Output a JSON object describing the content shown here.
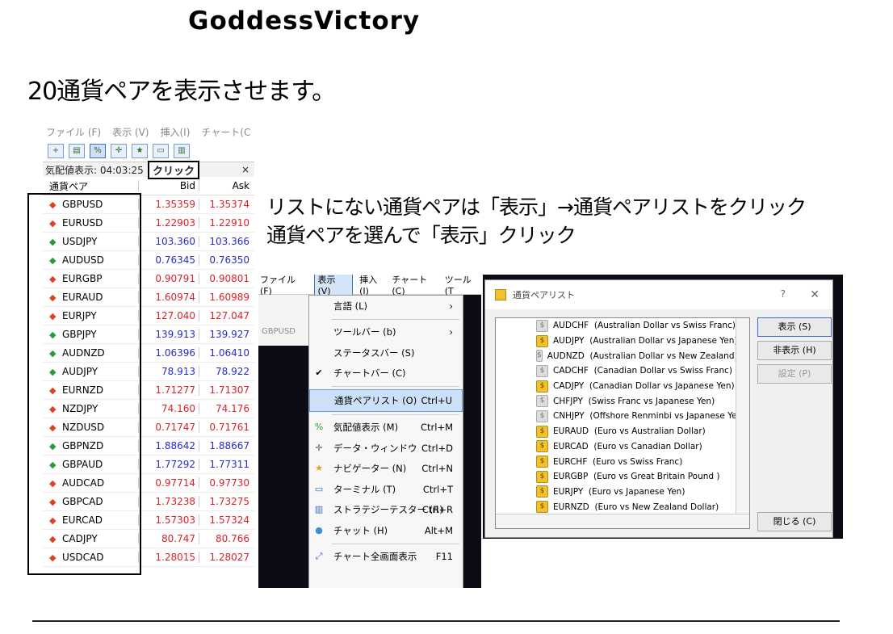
{
  "brand": "GoddessVictory",
  "heading": "20通貨ペアを表示させます。",
  "instruction": {
    "line1": "リストにない通貨ペアは「表示」→通貨ペアリストをクリック",
    "line2": "通貨ペアを選んで「表示」クリック"
  },
  "market_watch": {
    "menu": [
      "ファイル (F)",
      "表示 (V)",
      "挿入(I)",
      "チャート(C"
    ],
    "title": "気配値表示: 04:03:25",
    "click_label": "クリック",
    "close": "×",
    "headers": {
      "symbol": "通貨ペア",
      "bid": "Bid",
      "ask": "Ask"
    },
    "rows": [
      {
        "symbol": "GBPUSD",
        "bid": "1.35359",
        "ask": "1.35374",
        "dir": "down"
      },
      {
        "symbol": "EURUSD",
        "bid": "1.22903",
        "ask": "1.22910",
        "dir": "down"
      },
      {
        "symbol": "USDJPY",
        "bid": "103.360",
        "ask": "103.366",
        "dir": "up"
      },
      {
        "symbol": "AUDUSD",
        "bid": "0.76345",
        "ask": "0.76350",
        "dir": "up"
      },
      {
        "symbol": "EURGBP",
        "bid": "0.90791",
        "ask": "0.90801",
        "dir": "down"
      },
      {
        "symbol": "EURAUD",
        "bid": "1.60974",
        "ask": "1.60989",
        "dir": "down"
      },
      {
        "symbol": "EURJPY",
        "bid": "127.040",
        "ask": "127.047",
        "dir": "down"
      },
      {
        "symbol": "GBPJPY",
        "bid": "139.913",
        "ask": "139.927",
        "dir": "up"
      },
      {
        "symbol": "AUDNZD",
        "bid": "1.06396",
        "ask": "1.06410",
        "dir": "up"
      },
      {
        "symbol": "AUDJPY",
        "bid": "78.913",
        "ask": "78.922",
        "dir": "up"
      },
      {
        "symbol": "EURNZD",
        "bid": "1.71277",
        "ask": "1.71307",
        "dir": "down"
      },
      {
        "symbol": "NZDJPY",
        "bid": "74.160",
        "ask": "74.176",
        "dir": "down"
      },
      {
        "symbol": "NZDUSD",
        "bid": "0.71747",
        "ask": "0.71761",
        "dir": "down"
      },
      {
        "symbol": "GBPNZD",
        "bid": "1.88642",
        "ask": "1.88667",
        "dir": "up"
      },
      {
        "symbol": "GBPAUD",
        "bid": "1.77292",
        "ask": "1.77311",
        "dir": "up"
      },
      {
        "symbol": "AUDCAD",
        "bid": "0.97714",
        "ask": "0.97730",
        "dir": "down"
      },
      {
        "symbol": "GBPCAD",
        "bid": "1.73238",
        "ask": "1.73275",
        "dir": "down"
      },
      {
        "symbol": "EURCAD",
        "bid": "1.57303",
        "ask": "1.57324",
        "dir": "down"
      },
      {
        "symbol": "CADJPY",
        "bid": "80.747",
        "ask": "80.766",
        "dir": "down"
      },
      {
        "symbol": "USDCAD",
        "bid": "1.28015",
        "ask": "1.28027",
        "dir": "down"
      }
    ]
  },
  "view_menu": {
    "menubar": [
      "ファイル (F)",
      "表示 (V)",
      "挿入(I)",
      "チャート(C)",
      "ツール (T"
    ],
    "active_menu": "表示 (V)",
    "tab_label": "GBPUSD",
    "items": [
      {
        "label": "言語 (L)",
        "shortcut": "",
        "arrow": "›"
      },
      {
        "sep": true
      },
      {
        "label": "ツールバー (b)",
        "shortcut": "",
        "arrow": "›"
      },
      {
        "label": "ステータスバー (S)",
        "shortcut": ""
      },
      {
        "label": "チャートバー (C)",
        "shortcut": "",
        "check": "✔"
      },
      {
        "sep": true
      },
      {
        "label": "通貨ペアリスト (O)",
        "shortcut": "Ctrl+U",
        "highlight": true
      },
      {
        "sep": true
      },
      {
        "label": "気配値表示 (M)",
        "shortcut": "Ctrl+M",
        "icon": "market-watch-icon"
      },
      {
        "label": "データ・ウィンドウ",
        "shortcut": "Ctrl+D",
        "icon": "crosshair-icon"
      },
      {
        "label": "ナビゲーター (N)",
        "shortcut": "Ctrl+N",
        "icon": "navigator-icon"
      },
      {
        "label": "ターミナル (T)",
        "shortcut": "Ctrl+T",
        "icon": "terminal-icon"
      },
      {
        "label": "ストラテジーテスター (R)",
        "shortcut": "Ctrl+R",
        "icon": "tester-icon"
      },
      {
        "label": "チャット (H)",
        "shortcut": "Alt+M",
        "icon": "chat-icon"
      },
      {
        "sep": true
      },
      {
        "label": "チャート全画面表示",
        "shortcut": "F11",
        "icon": "fullscreen-icon"
      }
    ]
  },
  "symbols_dialog": {
    "title": "通貨ペアリスト",
    "help": "?",
    "close": "✕",
    "items": [
      {
        "code": "AUDCHF",
        "desc": "(Australian Dollar vs Swiss Franc)",
        "active": false
      },
      {
        "code": "AUDJPY",
        "desc": "(Australian Dollar vs Japanese Yen)",
        "active": true
      },
      {
        "code": "AUDNZD",
        "desc": "(Australian Dollar vs New Zealand Dollar)",
        "active": false
      },
      {
        "code": "CADCHF",
        "desc": "(Canadian Dollar vs Swiss Franc)",
        "active": false
      },
      {
        "code": "CADJPY",
        "desc": "(Canadian Dollar vs Japanese Yen)",
        "active": true
      },
      {
        "code": "CHFJPY",
        "desc": "(Swiss Franc vs Japanese Yen)",
        "active": false
      },
      {
        "code": "CNHJPY",
        "desc": "(Offshore Renminbi vs Japanese Yen)",
        "active": false
      },
      {
        "code": "EURAUD",
        "desc": "(Euro vs Australian Dollar)",
        "active": true
      },
      {
        "code": "EURCAD",
        "desc": "(Euro vs Canadian Dollar)",
        "active": true
      },
      {
        "code": "EURCHF",
        "desc": "(Euro vs Swiss Franc)",
        "active": true
      },
      {
        "code": "EURGBP",
        "desc": "(Euro vs Great Britain Pound )",
        "active": true
      },
      {
        "code": "EURJPY",
        "desc": "(Euro vs Japanese Yen)",
        "active": true
      },
      {
        "code": "EURNZD",
        "desc": "(Euro vs New Zealand Dollar)",
        "active": true
      }
    ],
    "buttons": {
      "show": "表示 (S)",
      "hide": "非表示 (H)",
      "settings": "設定 (P)",
      "close": "閉じる (C)"
    }
  }
}
